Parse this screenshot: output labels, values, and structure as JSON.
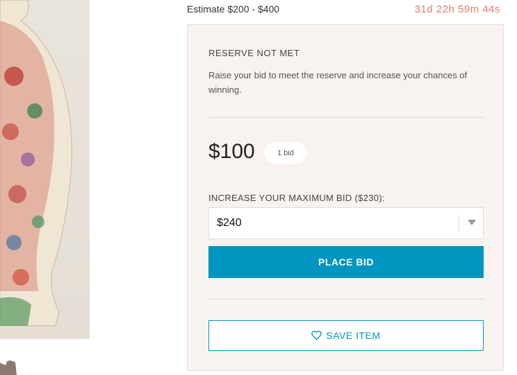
{
  "header": {
    "estimate": "Estimate $200 - $400",
    "countdown": "31d 22h 59m 44s"
  },
  "panel": {
    "reserve_title": "RESERVE NOT MET",
    "reserve_text": "Raise your bid to meet the reserve and increase your chances of winning.",
    "current_price": "$100",
    "bid_count": "1 bid",
    "max_bid_label": "INCREASE YOUR MAXIMUM BID ($230):",
    "max_bid_value": "$240",
    "place_bid_label": "PLACE BID",
    "save_item_label": "SAVE ITEM"
  },
  "colors": {
    "accent": "#0096bf",
    "countdown": "#e8796b",
    "panel_bg": "#f8f3f0"
  },
  "icons": [
    "twitter-icon",
    "heart-icon",
    "chevron-down-icon"
  ]
}
